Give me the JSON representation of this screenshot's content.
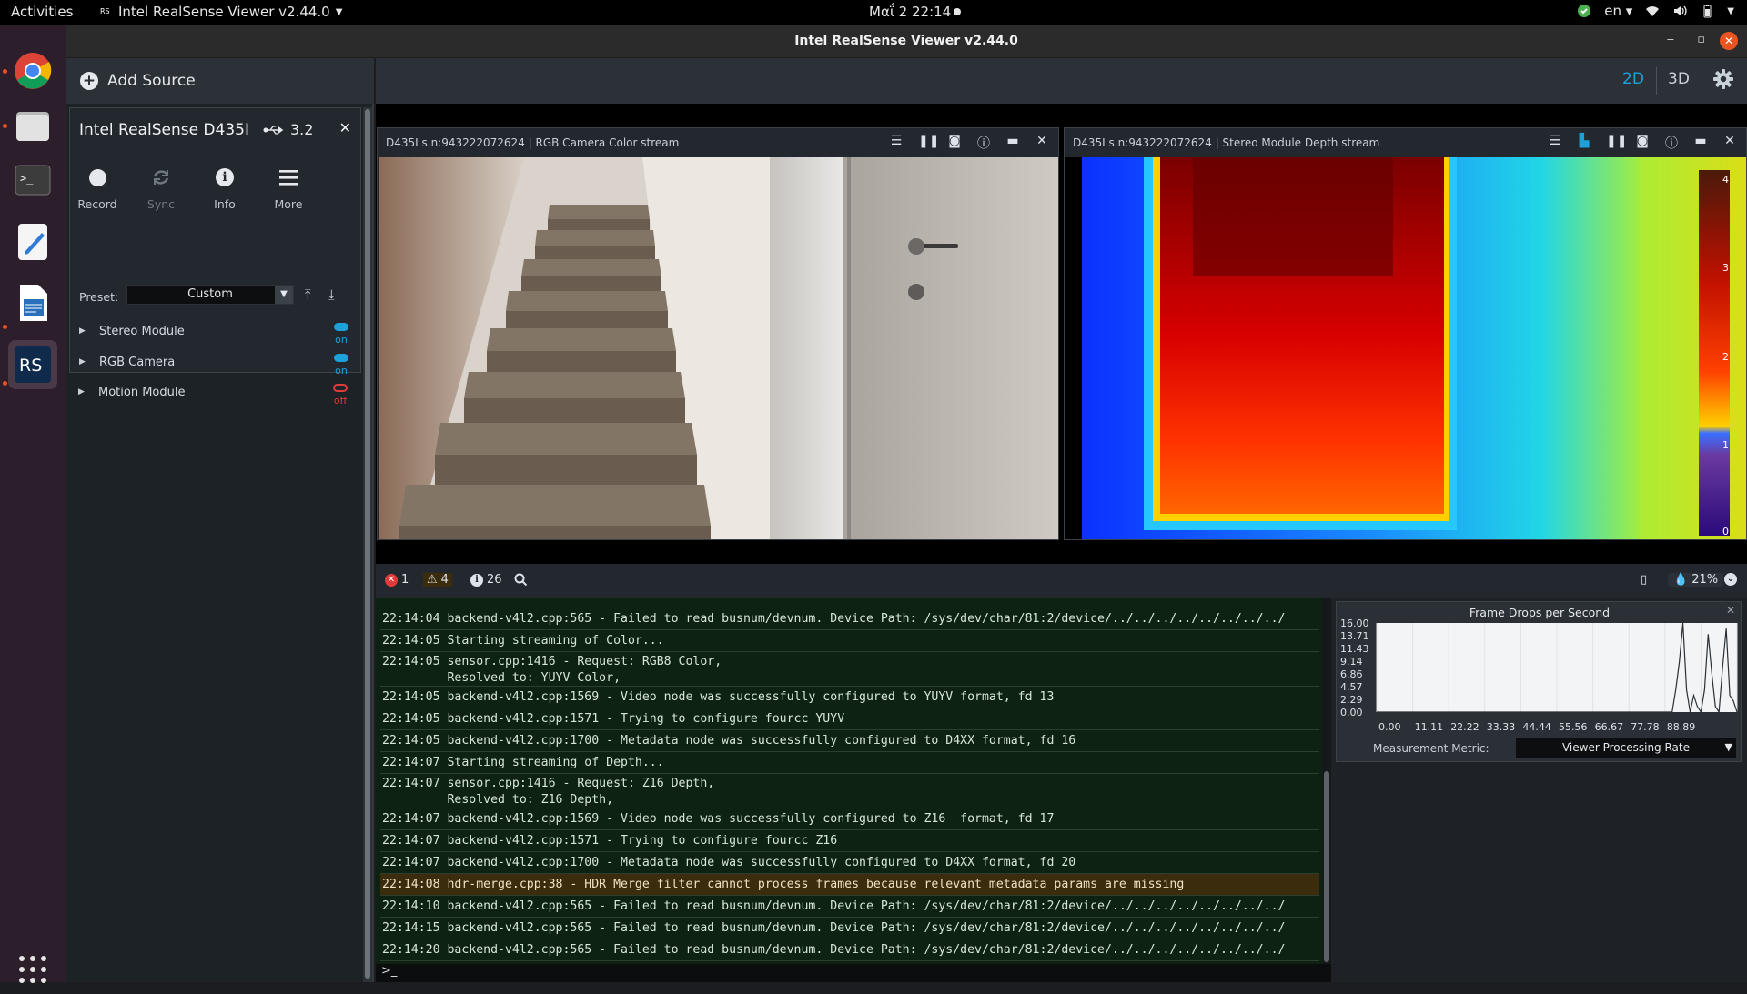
{
  "topbar": {
    "activities": "Activities",
    "app_menu": "Intel RealSense Viewer v2.44.0",
    "clock": "Μαΐ 2  22:14",
    "language": "en"
  },
  "window": {
    "title": "Intel RealSense Viewer v2.44.0"
  },
  "left_panel": {
    "add_source": "Add Source",
    "device": {
      "name": "Intel RealSense D435I",
      "usb": "3.2",
      "buttons": [
        {
          "label": "Record"
        },
        {
          "label": "Sync"
        },
        {
          "label": "Info"
        },
        {
          "label": "More"
        }
      ],
      "preset_label": "Preset:",
      "preset_value": "Custom",
      "modules": [
        {
          "name": "Stereo Module",
          "state": "on"
        },
        {
          "name": "RGB Camera",
          "state": "on"
        },
        {
          "name": "Motion Module",
          "state": "off"
        }
      ]
    }
  },
  "view_toolbar": {
    "mode_2d": "2D",
    "mode_3d": "3D"
  },
  "streams": {
    "color": {
      "title": "D435I s.n:943222072624 | RGB Camera Color stream"
    },
    "depth": {
      "title": "D435I s.n:943222072624 | Stereo Module Depth stream",
      "scale_labels": [
        "4",
        "3",
        "2",
        "1",
        "0"
      ]
    }
  },
  "log_bar": {
    "errors": "1",
    "warnings": "4",
    "infos": "26",
    "cpu": "21%"
  },
  "log": [
    {
      "text": "22:14:04 backend-v4l2.cpp:565 - Failed to read busnum/devnum. Device Path: /sys/dev/char/81:2/device/../../../../../../../../",
      "level": "info"
    },
    {
      "text": "22:14:05 Starting streaming of Color...",
      "level": "info"
    },
    {
      "text": "22:14:05 sensor.cpp:1416 - Request: RGB8 Color,\n         Resolved to: YUYV Color,",
      "level": "info"
    },
    {
      "text": "22:14:05 backend-v4l2.cpp:1569 - Video node was successfully configured to YUYV format, fd 13",
      "level": "info"
    },
    {
      "text": "22:14:05 backend-v4l2.cpp:1571 - Trying to configure fourcc YUYV",
      "level": "info"
    },
    {
      "text": "22:14:05 backend-v4l2.cpp:1700 - Metadata node was successfully configured to D4XX format, fd 16",
      "level": "info"
    },
    {
      "text": "22:14:07 Starting streaming of Depth...",
      "level": "info"
    },
    {
      "text": "22:14:07 sensor.cpp:1416 - Request: Z16 Depth,\n         Resolved to: Z16 Depth,",
      "level": "info"
    },
    {
      "text": "22:14:07 backend-v4l2.cpp:1569 - Video node was successfully configured to Z16  format, fd 17",
      "level": "info"
    },
    {
      "text": "22:14:07 backend-v4l2.cpp:1571 - Trying to configure fourcc Z16",
      "level": "info"
    },
    {
      "text": "22:14:07 backend-v4l2.cpp:1700 - Metadata node was successfully configured to D4XX format, fd 20",
      "level": "info"
    },
    {
      "text": "22:14:08 hdr-merge.cpp:38 - HDR Merge filter cannot process frames because relevant metadata params are missing",
      "level": "warn"
    },
    {
      "text": "22:14:10 backend-v4l2.cpp:565 - Failed to read busnum/devnum. Device Path: /sys/dev/char/81:2/device/../../../../../../../../",
      "level": "info"
    },
    {
      "text": "22:14:15 backend-v4l2.cpp:565 - Failed to read busnum/devnum. Device Path: /sys/dev/char/81:2/device/../../../../../../../../",
      "level": "info"
    },
    {
      "text": "22:14:20 backend-v4l2.cpp:565 - Failed to read busnum/devnum. Device Path: /sys/dev/char/81:2/device/../../../../../../../../",
      "level": "info"
    }
  ],
  "command_prompt": ">_",
  "frame_drops": {
    "title": "Frame Drops per Second",
    "metric_label": "Measurement Metric:",
    "metric_value": "Viewer Processing Rate",
    "chart_data": {
      "type": "line",
      "title": "Frame Drops per Second",
      "y_ticks": [
        "16.00",
        "13.71",
        "11.43",
        "9.14",
        "6.86",
        "4.57",
        "2.29",
        "0.00"
      ],
      "x_ticks": [
        "0.00",
        "11.11",
        "22.22",
        "33.33",
        "44.44",
        "55.56",
        "66.67",
        "77.78",
        "88.89"
      ],
      "ylim": [
        0,
        16
      ],
      "xlim": [
        0,
        100
      ],
      "series": [
        {
          "x": [
            0,
            10,
            20,
            30,
            40,
            50,
            60,
            70,
            82,
            83,
            84,
            85,
            86,
            87,
            88,
            89,
            90,
            91,
            92,
            93,
            94,
            95,
            96,
            97,
            98,
            99,
            100
          ],
          "y": [
            0,
            0,
            0,
            0,
            0,
            0,
            0,
            0,
            0,
            4,
            9,
            16,
            4,
            0,
            3,
            1,
            0,
            4,
            14,
            7,
            1,
            0,
            8,
            15,
            3,
            2,
            0
          ]
        }
      ]
    }
  }
}
